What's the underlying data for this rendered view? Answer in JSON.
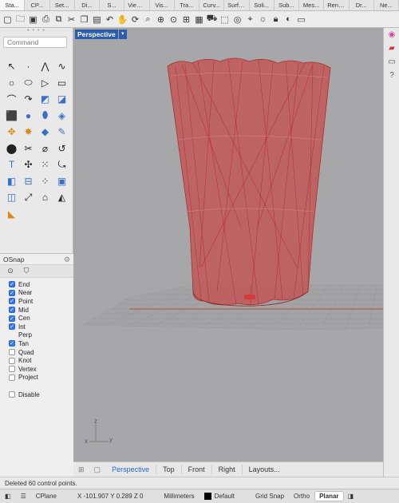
{
  "tabs": [
    "Sta...",
    "CP...",
    "Set...",
    "Di...",
    "S...",
    "Viewp...",
    "Vis...",
    "Tra...",
    "Curv...",
    "Surfa...",
    "Soli...",
    "Sub...",
    "Mes...",
    "Rend...",
    "Dr...",
    "Ne..."
  ],
  "toolbar_icons": [
    "new-file-icon",
    "open-folder-icon",
    "save-icon",
    "print-icon",
    "import-icon",
    "cut-icon",
    "copy-icon",
    "paste-icon",
    "undo-icon",
    "pan-hand-icon",
    "rotate-view-icon",
    "zoom-window-icon",
    "zoom-extents-icon",
    "zoom-selected-icon",
    "viewport-layout-icon",
    "grid-icon",
    "car-icon",
    "select-icon",
    "target-icon",
    "osnap-icon",
    "light-bulb-icon",
    "lock-icon",
    "color-icon",
    "more-icon"
  ],
  "command": {
    "placeholder": "Command"
  },
  "osnap": {
    "title": "OSnap",
    "items": [
      {
        "label": "End",
        "checked": true
      },
      {
        "label": "Near",
        "checked": true
      },
      {
        "label": "Point",
        "checked": true
      },
      {
        "label": "Mid",
        "checked": true
      },
      {
        "label": "Cen",
        "checked": true
      },
      {
        "label": "Int",
        "checked": true
      },
      {
        "label": "Perp",
        "checked": false
      },
      {
        "label": "Tan",
        "checked": true
      },
      {
        "label": "Quad",
        "checked": false
      },
      {
        "label": "Knot",
        "checked": false
      },
      {
        "label": "Vertex",
        "checked": false
      },
      {
        "label": "Project",
        "checked": false
      }
    ],
    "disable_label": "Disable"
  },
  "viewport": {
    "name": "Perspective",
    "axes": {
      "z": "z",
      "x": "x",
      "y": "y"
    }
  },
  "viewport_tabs": [
    "Perspective",
    "Top",
    "Front",
    "Right",
    "Layouts..."
  ],
  "command_history": "Deleted 60 control points.",
  "status": {
    "cplane": "CPlane",
    "coords": "X -101.907 Y 0.289 Z 0",
    "units": "Millimeters",
    "layer": "Default",
    "grid_snap": "Grid Snap",
    "ortho": "Ortho",
    "planar": "Planar"
  },
  "colors": {
    "accent": "#2a5dae",
    "object_fill": "#c84a4a",
    "viewport_bg": "#a7a7a9"
  }
}
